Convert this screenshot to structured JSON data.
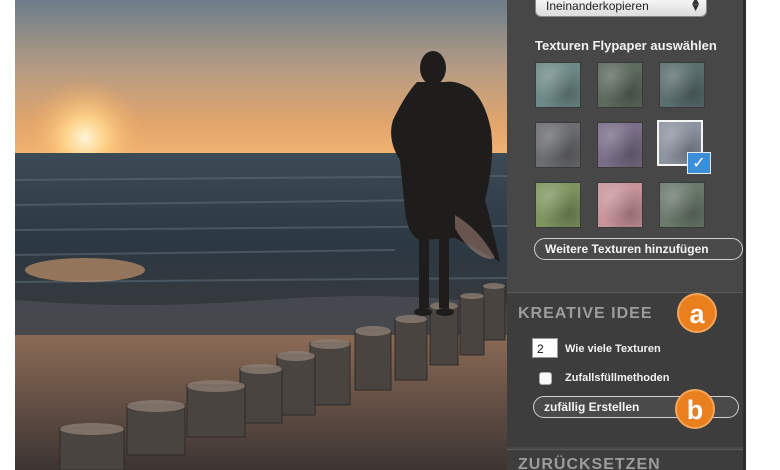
{
  "panel": {
    "blend_mode": "Ineinanderkopieren",
    "textures_label": "Texturen Flypaper auswählen",
    "textures": [
      {
        "name": "texture-1",
        "color": "#6e8a88",
        "selected": false
      },
      {
        "name": "texture-2",
        "color": "#5d6a5e",
        "selected": false
      },
      {
        "name": "texture-3",
        "color": "#5a6f6e",
        "selected": false
      },
      {
        "name": "texture-4",
        "color": "#6c6d70",
        "selected": false
      },
      {
        "name": "texture-5",
        "color": "#7a6e88",
        "selected": false
      },
      {
        "name": "texture-6",
        "color": "#8e93a0",
        "selected": true
      },
      {
        "name": "texture-7",
        "color": "#7f9560",
        "selected": false
      },
      {
        "name": "texture-8",
        "color": "#c7949a",
        "selected": false
      },
      {
        "name": "texture-9",
        "color": "#6b7a6d",
        "selected": false
      }
    ],
    "add_textures_button": "Weitere Texturen hinzufügen",
    "kreativ": {
      "heading": "KREATIVE IDEE",
      "badge_a": "a",
      "count_value": "2",
      "count_label": "Wie viele Texturen",
      "random_fill_label": "Zufallsfüllmethoden",
      "random_button": "zufällig Erstellen",
      "badge_b": "b"
    },
    "reset_heading": "ZURÜCKSETZEN"
  },
  "colors": {
    "panel_bg": "#474747",
    "accent_orange": "#ea7f1e",
    "check_blue": "#3b8fd9"
  }
}
